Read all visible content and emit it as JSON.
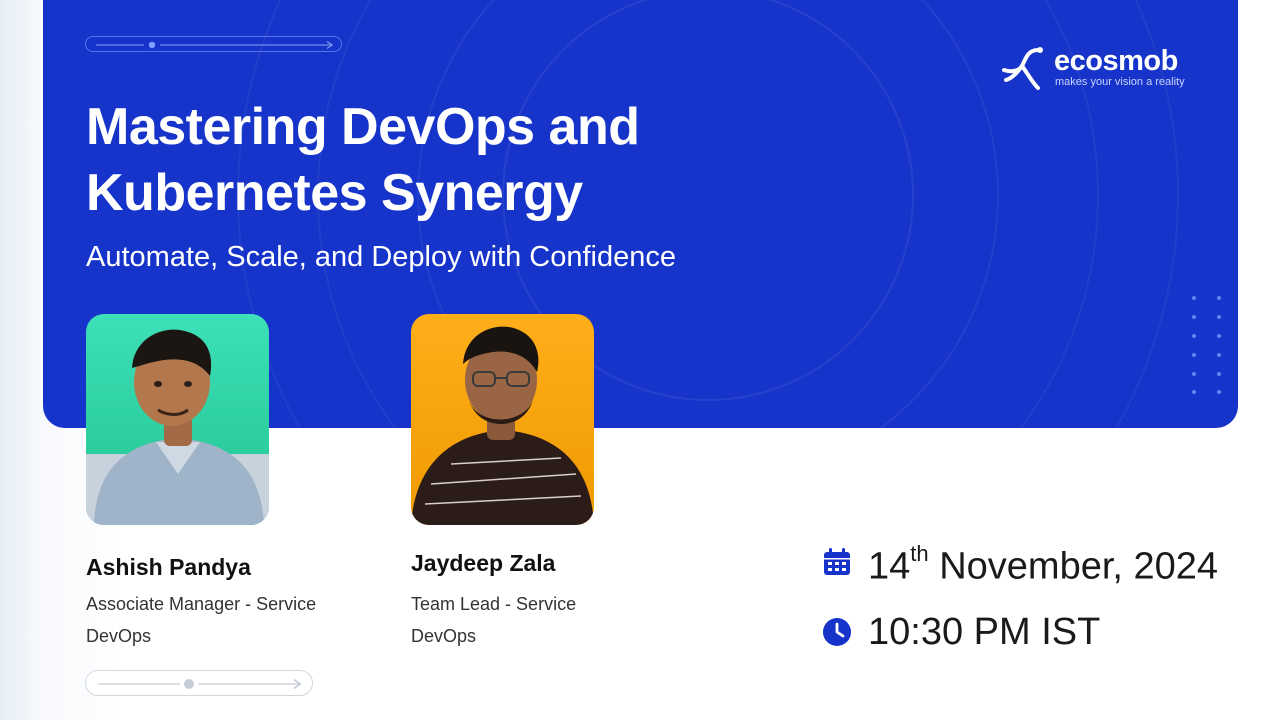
{
  "brand": {
    "name": "ecosmob",
    "tagline": "makes your vision a reality",
    "primary_color": "#1634c9"
  },
  "headline": {
    "title": "Mastering DevOps and\nKubernetes Synergy",
    "subtitle": "Automate, Scale, and Deploy with Confidence"
  },
  "speakers": [
    {
      "name": "Ashish Pandya",
      "role": "Associate Manager - Service DevOps"
    },
    {
      "name": "Jaydeep Zala",
      "role": "Team Lead - Service DevOps"
    }
  ],
  "event": {
    "date_day": "14",
    "date_suffix": "th",
    "date_rest": " November, 2024",
    "time": "10:30 PM IST",
    "date_icon": "calendar-icon",
    "time_icon": "clock-icon"
  }
}
